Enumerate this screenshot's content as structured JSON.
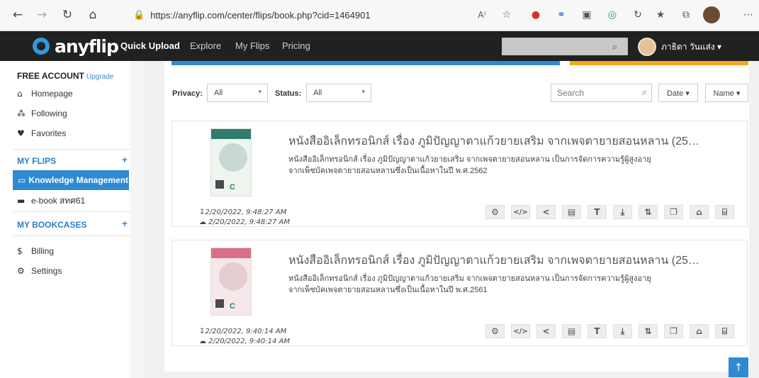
{
  "browser": {
    "url": "https://anyflip.com/center/flips/book.php?cid=1464901",
    "back_icon": "←",
    "forward_icon": "→",
    "reload_icon": "↻",
    "home_icon": "⌂",
    "lock_icon": "🔒",
    "reader_label": "A⁾",
    "more_icon": "⋯"
  },
  "app": {
    "logo_text": "anyflip",
    "nav": [
      "Quick Upload",
      "Explore",
      "My Flips",
      "Pricing"
    ],
    "search_icon": "⌕",
    "user_name": "ภาธิดา วันแส่ง ▾"
  },
  "sidebar": {
    "account": "FREE ACCOUNT",
    "upgrade": "Upgrade",
    "items": [
      {
        "icon": "⌂",
        "label": "Homepage"
      },
      {
        "icon": "⁂",
        "label": "Following"
      },
      {
        "icon": "♥",
        "label": "Favorites"
      }
    ],
    "my_flips": "MY FLIPS",
    "plus": "+",
    "active_folder": "Knowledge Management",
    "folder_icon": "▬",
    "other_folder": "e-book สทศ61",
    "my_bookcases": "MY BOOKCASES",
    "billing": "Billing",
    "billing_icon": "$",
    "settings": "Settings",
    "settings_icon": "⚙"
  },
  "filters": {
    "privacy_label": "Privacy:",
    "privacy_value": "All",
    "status_label": "Status:",
    "status_value": "All",
    "caret": "▾",
    "search_placeholder": "Search",
    "sort_date": "Date ▾",
    "sort_name": "Name ▾"
  },
  "books": [
    {
      "title": "หนังสืออิเล็กทรอนิกส์ เรื่อง ภูมิปัญญาตาแก้วยายเสริม จากเพจตายายสอนหลาน (25…",
      "desc": "หนังสืออิเล็กทรอนิกส์ เรื่อง ภูมิปัญญาตาแก้วยายเสริม จากเพจตายายสอนหลาน เป็นการจัดการความรู้ผู้สูงอายุจากเพ็ชบัคเพจตายายสอนหลานซึ่งเป็นเนื้อหาในปี พ.ศ.2562",
      "modified": "↧2/20/2022, 9:48:27 AM",
      "created": "☁ 2/20/2022, 9:48:27 AM"
    },
    {
      "title": "หนังสืออิเล็กทรอนิกส์ เรื่อง ภูมิปัญญาตาแก้วยายเสริม จากเพจตายายสอนหลาน (25…",
      "desc": "หนังสืออิเล็กทรอนิกส์ เรื่อง ภูมิปัญญาตาแก้วยายเสริม จากเพจตายายสอนหลาน เป็นการจัดการความรู้ผู้สูงอายุจากเพ็ชบัคเพจตายายสอนหลานซึ่งเป็นเนื้อหาในปี พ.ศ.2561",
      "modified": "↧2/20/2022, 9:40:14 AM",
      "created": "☁ 2/20/2022, 9:40:14 AM"
    }
  ],
  "tools": [
    "⚙",
    "</>",
    "<",
    "▤",
    "T",
    "⤓",
    "⇅",
    "❐",
    "⌂",
    "⌸"
  ],
  "tool_names": [
    "settings-icon",
    "embed-icon",
    "share-icon",
    "bookmark-icon",
    "text-icon",
    "download-icon",
    "move-icon",
    "copy-icon",
    "lock-icon",
    "delete-icon"
  ],
  "scroll_top": "↑"
}
